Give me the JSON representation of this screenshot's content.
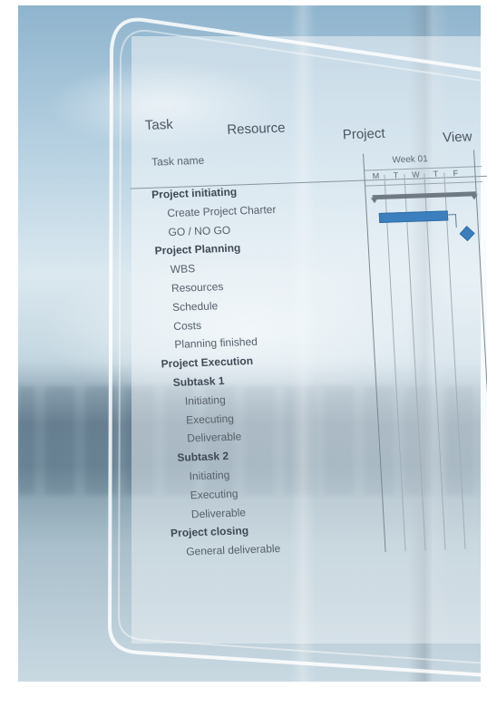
{
  "menu": {
    "task": "Task",
    "resource": "Resource",
    "project": "Project",
    "view": "View"
  },
  "columns": {
    "task_name": "Task name",
    "week": "Week 01"
  },
  "days": [
    "M",
    "T",
    "W",
    "T",
    "F"
  ],
  "tasks": [
    {
      "label": "Project initiating",
      "bold": true
    },
    {
      "label": "Create Project Charter"
    },
    {
      "label": "GO / NO GO"
    },
    {
      "label": "Project Planning",
      "bold": true
    },
    {
      "label": "WBS"
    },
    {
      "label": "Resources"
    },
    {
      "label": "Schedule"
    },
    {
      "label": "Costs"
    },
    {
      "label": "Planning finished"
    },
    {
      "label": "Project Execution",
      "bold": true
    },
    {
      "label": "Subtask 1",
      "bold": true
    },
    {
      "label": "Initiating"
    },
    {
      "label": "Executing"
    },
    {
      "label": "Deliverable"
    },
    {
      "label": "Subtask 2",
      "bold": true
    },
    {
      "label": "Initiating"
    },
    {
      "label": "Executing"
    },
    {
      "label": "Deliverable"
    },
    {
      "label": "Project closing",
      "bold": true
    },
    {
      "label": "General deliverable"
    }
  ],
  "colors": {
    "bar": "#3c7fbe",
    "summary": "#6f7a84"
  },
  "gantt": {
    "icons": [
      "summary-bar",
      "task-bar",
      "milestone-diamond",
      "dependency-arrow"
    ]
  }
}
